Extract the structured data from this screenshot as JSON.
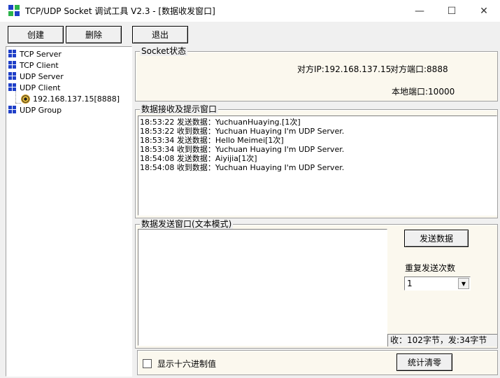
{
  "window": {
    "title": "TCP/UDP Socket 调试工具 V2.3  - [数据收发窗口]",
    "controls": {
      "minimize": "—",
      "maximize": "☐",
      "close": "✕"
    }
  },
  "toolbar": {
    "create_label": "创建",
    "delete_label": "删除",
    "exit_label": "退出"
  },
  "tree": {
    "items": [
      {
        "label": "TCP Server"
      },
      {
        "label": "TCP Client"
      },
      {
        "label": "UDP Server"
      },
      {
        "label": "UDP Client"
      },
      {
        "label": "192.168.137.15[8888]"
      },
      {
        "label": "UDP Group"
      }
    ]
  },
  "socket_status": {
    "title": "Socket状态",
    "remote_ip": "对方IP:192.168.137.15",
    "remote_port": "对方端口:8888",
    "local_port": "本地端口:10000"
  },
  "receive": {
    "title": "数据接收及提示窗口",
    "lines": [
      "18:53:22 发送数据：YuchuanHuaying.[1次]",
      "18:53:22 收到数据：Yuchuan Huaying I'm UDP Server.",
      "18:53:34 发送数据：Hello Meimei[1次]",
      "18:53:34 收到数据：Yuchuan Huaying I'm UDP Server.",
      "18:54:08 发送数据：Aiyijia[1次]",
      "18:54:08 收到数据：Yuchuan Huaying I'm UDP Server."
    ]
  },
  "send": {
    "title": "数据发送窗口(文本模式)",
    "send_button": "发送数据",
    "repeat_label": "重复发送次数",
    "repeat_value": "1",
    "stats": "收：102字节，发:34字节",
    "hex_label": "显示十六进制值",
    "reset_button": "统计清零"
  },
  "colors": {
    "group_bg": "#fbf8ee",
    "icon_blue": "#1f3fc8"
  }
}
